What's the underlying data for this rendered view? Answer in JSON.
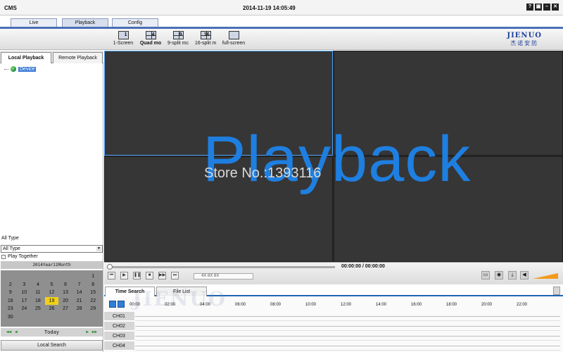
{
  "window": {
    "title": "CMS",
    "datetime": "2014-11-19 14:05:49",
    "buttons": [
      "?",
      "▣",
      "–",
      "✕"
    ]
  },
  "main_tabs": [
    "Live",
    "Playback",
    "Config"
  ],
  "toolbar": {
    "layouts": [
      {
        "label": "1-Screen",
        "num": "1"
      },
      {
        "label": "Quad mo",
        "num": "4"
      },
      {
        "label": "9-split mc",
        "num": "9"
      },
      {
        "label": "16-split m",
        "num": "16"
      },
      {
        "label": "full-screen",
        "num": ""
      }
    ],
    "logo_text": "JIENUO",
    "logo_cn": "杰诺安防"
  },
  "left_panel": {
    "tabs": [
      "Local Playback",
      "Remote Playback"
    ],
    "tree_root": "Device",
    "type_label": "All Type",
    "type_value": "All Type",
    "play_together": "Play Together",
    "calendar_title": "2014Year11Month",
    "calendar_days": [
      "",
      "",
      "",
      "",
      "",
      "",
      "1",
      "2",
      "3",
      "4",
      "5",
      "6",
      "7",
      "8",
      "9",
      "10",
      "11",
      "12",
      "13",
      "14",
      "15",
      "16",
      "17",
      "18",
      "19",
      "20",
      "21",
      "22",
      "23",
      "24",
      "25",
      "26",
      "27",
      "28",
      "29",
      "30",
      "",
      "",
      "",
      "",
      "",
      ""
    ],
    "selected_day": "19",
    "today_label": "Today",
    "local_search": "Local Search"
  },
  "video": {
    "watermark_title": "Playback",
    "watermark_store": "Store No.:1393116"
  },
  "controls": {
    "timecode": "00:00:00 / 00:00:00",
    "speed_label": "4X  8X  8X",
    "progress": 0
  },
  "search_tabs": [
    "Time Search",
    "File List"
  ],
  "timeline": {
    "ticks": [
      "00:00",
      "02:00",
      "04:00",
      "06:00",
      "08:00",
      "10:00",
      "12:00",
      "14:00",
      "16:00",
      "18:00",
      "20:00",
      "22:00"
    ],
    "channels": [
      "CH01",
      "CH02",
      "CH03",
      "CH04"
    ]
  },
  "colors": {
    "accent": "#1c63b5",
    "watermark_blue": "#1e7fe0",
    "selected_day": "#f0cf18"
  }
}
